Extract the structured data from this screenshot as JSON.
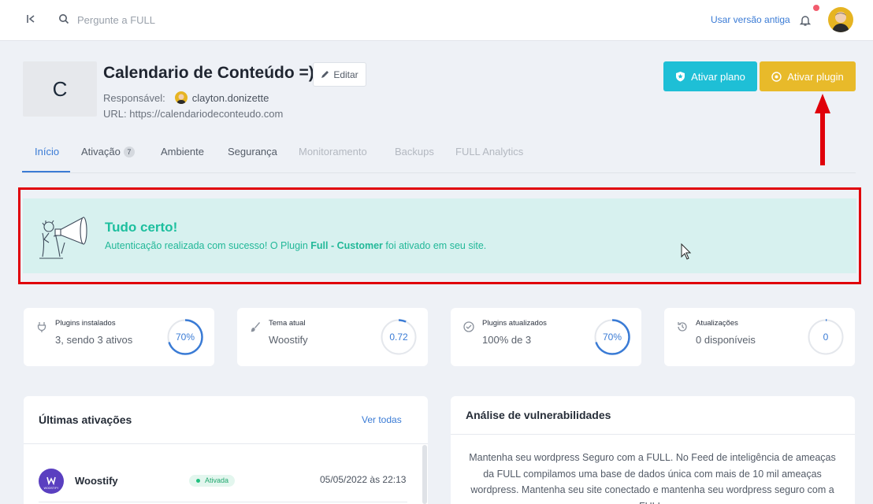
{
  "topbar": {
    "search_placeholder": "Pergunte a FULL",
    "old_version_link": "Usar versão antiga",
    "icons": {
      "collapse": "collapse-left-icon",
      "search": "search-icon",
      "bell": "bell-icon"
    }
  },
  "site": {
    "logo_letter": "C",
    "title": "Calendario de Conteúdo =)",
    "edit_label": "Editar",
    "responsible_label": "Responsável:",
    "responsible_name": "clayton.donizette",
    "url_label": "URL: https://calendariodeconteudo.com"
  },
  "actions": {
    "plan_label": "Ativar plano",
    "plugin_label": "Ativar plugin"
  },
  "tabs": [
    {
      "label": "Início",
      "active": true
    },
    {
      "label": "Ativação",
      "badge": "7"
    },
    {
      "label": "Ambiente"
    },
    {
      "label": "Segurança"
    },
    {
      "label": "Monitoramento",
      "disabled": true
    },
    {
      "label": "Backups",
      "disabled": true
    },
    {
      "label": "FULL Analytics",
      "disabled": true
    }
  ],
  "alert": {
    "title": "Tudo certo!",
    "msg_before": "Autenticação realizada com sucesso! O Plugin ",
    "msg_bold": "Full - Customer",
    "msg_after": " foi ativado em seu site."
  },
  "stats": [
    {
      "label": "Plugins instalados",
      "value": "3, sendo 3 ativos",
      "gauge_text": "70%",
      "gauge_fraction": 0.7,
      "icon": "plug-icon"
    },
    {
      "label": "Tema atual",
      "value": "Woostify",
      "gauge_text": "0.72",
      "gauge_fraction": 0.07,
      "icon": "brush-icon"
    },
    {
      "label": "Plugins atualizados",
      "value": "100% de 3",
      "gauge_text": "70%",
      "gauge_fraction": 0.7,
      "icon": "check-circle-icon"
    },
    {
      "label": "Atualizações",
      "value": "0 disponíveis",
      "gauge_text": "0",
      "gauge_fraction": 0.01,
      "icon": "history-icon"
    }
  ],
  "activations": {
    "title": "Últimas ativações",
    "see_all": "Ver todas",
    "items": [
      {
        "name": "Woostify",
        "status": "Ativada",
        "date": "05/05/2022 às 22:13",
        "icon_text": "WOOSTIFY"
      }
    ]
  },
  "vulnerability": {
    "title": "Análise de vulnerabilidades",
    "text": "Mantenha seu wordpress Seguro com a FULL. No Feed de inteligência de ameaças da FULL compilamos uma base de dados única com mais de 10 mil ameaças wordpress. Mantenha seu site conectado e mantenha seu wordpress seguro com a FULL."
  },
  "colors": {
    "accent": "#3a7bd5",
    "plan": "#1ebfd6",
    "plugin": "#e8ba2a",
    "success": "#1dbf9e",
    "annotation": "#e0000a"
  }
}
